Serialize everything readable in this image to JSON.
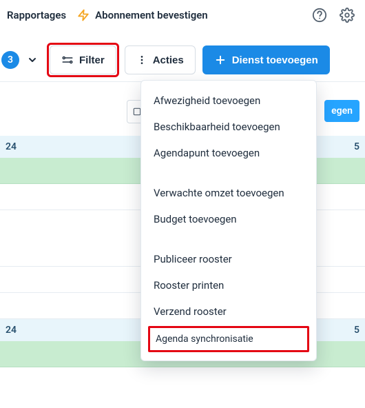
{
  "header": {
    "reports_label": "Rapportages",
    "confirm_sub_label": "Abonnement bevestigen"
  },
  "toolbar": {
    "badge_count": "3",
    "filter_label": "Filter",
    "actions_label": "Acties",
    "add_shift_label": "Dienst toevoegen"
  },
  "schedule": {
    "add_suffix": "egen",
    "day1_left": "24",
    "day1_right": "5",
    "day2_left": "24",
    "day2_right": "5"
  },
  "menu": {
    "items": [
      "Afwezigheid toevoegen",
      "Beschikbaarheid toevoegen",
      "Agendapunt toevoegen"
    ],
    "items2": [
      "Verwachte omzet toevoegen",
      "Budget toevoegen"
    ],
    "items3": [
      "Publiceer rooster",
      "Rooster printen",
      "Verzend rooster"
    ],
    "highlight": "Agenda synchronisatie"
  }
}
